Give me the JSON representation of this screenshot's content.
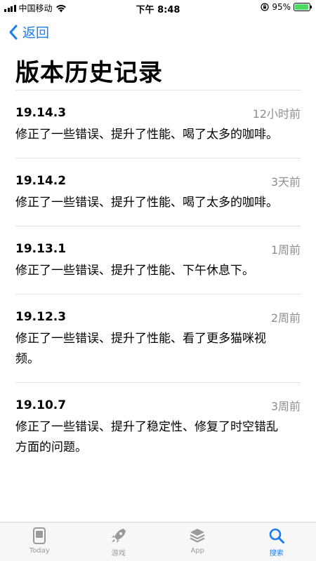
{
  "status_bar": {
    "carrier": "中国移动",
    "time": "下午 8:48",
    "battery_percent": "95%",
    "battery_level": 0.95,
    "battery_color": "#4cd964"
  },
  "nav": {
    "back_label": "返回",
    "back_icon": "chevron-left-icon",
    "accent_color": "#1a7cf5"
  },
  "page": {
    "title": "版本历史记录"
  },
  "versions": [
    {
      "version": "19.14.3",
      "age": "12小时前",
      "notes": "修正了一些错误、提升了性能、喝了太多的咖啡。"
    },
    {
      "version": "19.14.2",
      "age": "3天前",
      "notes": "修正了一些错误、提升了性能、喝了太多的咖啡。"
    },
    {
      "version": "19.13.1",
      "age": "1周前",
      "notes": "修正了一些错误、提升了性能、下午休息下。"
    },
    {
      "version": "19.12.3",
      "age": "2周前",
      "notes": "修正了一些错误、提升了性能、看了更多猫咪视频。"
    },
    {
      "version": "19.10.7",
      "age": "3周前",
      "notes": "修正了一些错误、提升了稳定性、修复了时空错乱方面的问题。"
    }
  ],
  "tab_bar": {
    "tabs": [
      {
        "label": "Today",
        "icon": "today-icon",
        "active": false
      },
      {
        "label": "游戏",
        "icon": "rocket-icon",
        "active": false
      },
      {
        "label": "App",
        "icon": "app-stack-icon",
        "active": false
      },
      {
        "label": "搜索",
        "icon": "search-icon",
        "active": true
      }
    ]
  }
}
